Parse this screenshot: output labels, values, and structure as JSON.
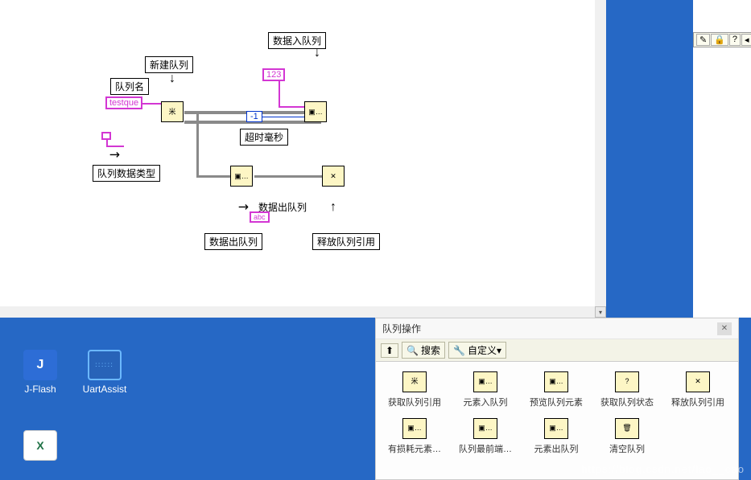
{
  "diagram": {
    "labels": {
      "queue_name": "队列名",
      "testque": "testque",
      "new_queue": "新建队列",
      "data_type": "队列数据类型",
      "enqueue": "数据入队列",
      "const_123": "123",
      "const_neg1": "-1",
      "timeout_ms": "超时毫秒",
      "dequeue_caption": "数据出队列",
      "dequeue_label": "数据出队列",
      "abc": "abc",
      "release": "释放队列引用"
    },
    "node_glyphs": {
      "obtain": "米",
      "queue": "▣…",
      "close": "✕"
    }
  },
  "desktop": {
    "jflash": "J-Flash",
    "jflash_icon_text": "J",
    "uartassist": "UartAssist",
    "excel_icon_text": "X"
  },
  "palette": {
    "title": "队列操作",
    "toolbar": {
      "up_icon": "⬆",
      "search_icon": "🔍",
      "search_label": "搜索",
      "custom_icon": "🔧",
      "custom_label": "自定义▾"
    },
    "row1": [
      {
        "glyph": "米",
        "label": "获取队列引用"
      },
      {
        "glyph": "▣…",
        "label": "元素入队列"
      },
      {
        "glyph": "▣…",
        "label": "预览队列元素"
      },
      {
        "glyph": "?",
        "label": "获取队列状态"
      },
      {
        "glyph": "✕",
        "label": "释放队列引用"
      }
    ],
    "row2": [
      {
        "glyph": "▣…",
        "label": "有损耗元素…"
      },
      {
        "glyph": "▣…",
        "label": "队列最前端…"
      },
      {
        "glyph": "▣…",
        "label": "元素出队列"
      },
      {
        "glyph": "🗑",
        "label": "清空队列"
      }
    ]
  },
  "helpbar": {
    "a": "✎",
    "b": "🔒",
    "c": "?",
    "d": "◂"
  },
  "watermark": "https://blog.csdn.net/lao__cao"
}
